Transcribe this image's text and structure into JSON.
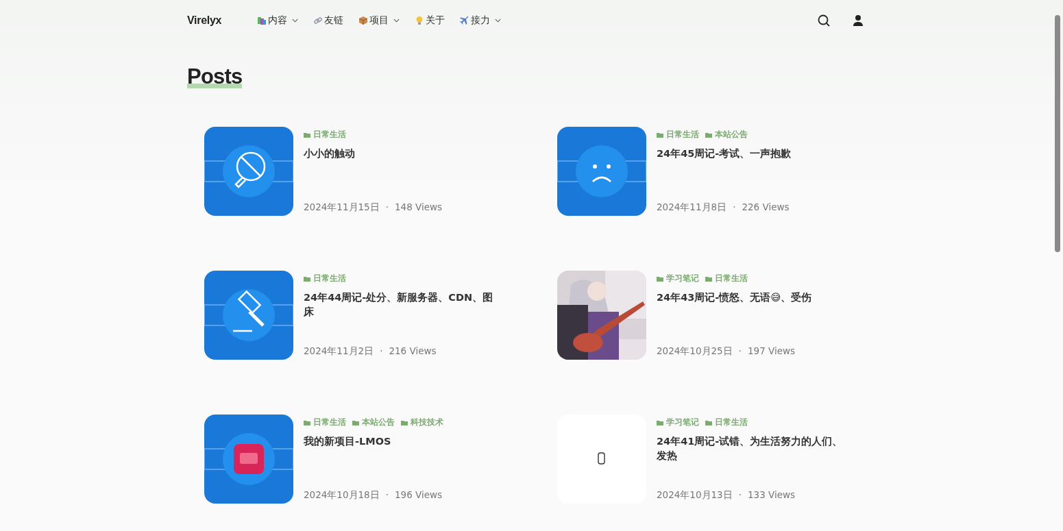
{
  "site": {
    "logo": "Virelyx"
  },
  "nav": [
    {
      "label": "内容",
      "dropdown": true
    },
    {
      "label": "友链",
      "dropdown": false
    },
    {
      "label": "项目",
      "dropdown": true
    },
    {
      "label": "关于",
      "dropdown": false
    },
    {
      "label": "接力",
      "dropdown": true
    }
  ],
  "page_title": "Posts",
  "posts": [
    {
      "categories": [
        "日常生活"
      ],
      "title": "小小的触动",
      "date": "2024年11月15日",
      "separator": "·",
      "views": "148 Views",
      "thumbnail": {
        "kind": "picture"
      }
    },
    {
      "categories": [
        "日常生活",
        "本站公告"
      ],
      "title": "24年45周记-考试、一声抱歉",
      "date": "2024年11月8日",
      "separator": "·",
      "views": "226 Views",
      "thumbnail": {
        "kind": "picture"
      }
    },
    {
      "categories": [
        "日常生活"
      ],
      "title": "24年44周记-处分、新服务器、CDN、图床",
      "date": "2024年11月2日",
      "separator": "·",
      "views": "216 Views",
      "thumbnail": {
        "kind": "picture"
      }
    },
    {
      "categories": [
        "学习笔记",
        "日常生活"
      ],
      "title": "24年43周记-愤怒、无语😅、受伤",
      "date": "2024年10月25日",
      "separator": "·",
      "views": "197 Views",
      "thumbnail": {
        "kind": "picture"
      }
    },
    {
      "categories": [
        "日常生活",
        "本站公告",
        "科技技术"
      ],
      "title": "我的新项目-LMOS",
      "date": "2024年10月18日",
      "separator": "·",
      "views": "196 Views",
      "thumbnail": {
        "kind": "picture"
      }
    },
    {
      "categories": [
        "学习笔记",
        "日常生活"
      ],
      "title": "24年41周记-试错、为生活努力的人们、发热",
      "date": "2024年10月13日",
      "separator": "·",
      "views": "133 Views",
      "thumbnail": {
        "kind": "picture"
      }
    }
  ]
}
